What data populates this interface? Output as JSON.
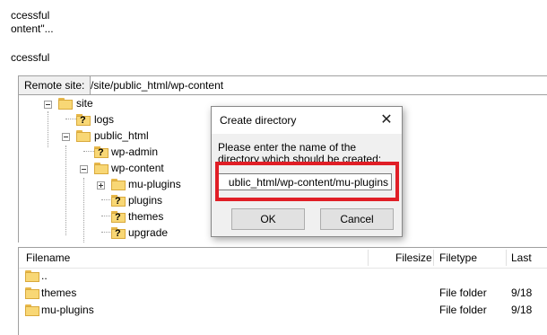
{
  "log_lines": [
    "ccessful",
    "ontent\"...",
    "",
    "ccessful"
  ],
  "remote_site": {
    "label": "Remote site:",
    "path": "/site/public_html/wp-content"
  },
  "tree": {
    "site": "site",
    "logs": "logs",
    "public_html": "public_html",
    "wp_admin": "wp-admin",
    "wp_content": "wp-content",
    "mu_plugins": "mu-plugins",
    "plugins": "plugins",
    "themes": "themes",
    "upgrade": "upgrade"
  },
  "file_list": {
    "headers": {
      "filename": "Filename",
      "filesize": "Filesize",
      "filetype": "Filetype",
      "last": "Last"
    },
    "rows": [
      {
        "name": "..",
        "type": "",
        "last": ""
      },
      {
        "name": "themes",
        "type": "File folder",
        "last": "9/18"
      },
      {
        "name": "mu-plugins",
        "type": "File folder",
        "last": "9/18"
      }
    ]
  },
  "dialog": {
    "title": "Create directory",
    "close_glyph": "✕",
    "prompt": "Please enter the name of the directory which should be created:",
    "input_value": "ublic_html/wp-content/mu-plugins",
    "ok_label": "OK",
    "cancel_label": "Cancel"
  },
  "colors": {
    "highlight": "#e01e26",
    "folder": "#f8d775"
  }
}
